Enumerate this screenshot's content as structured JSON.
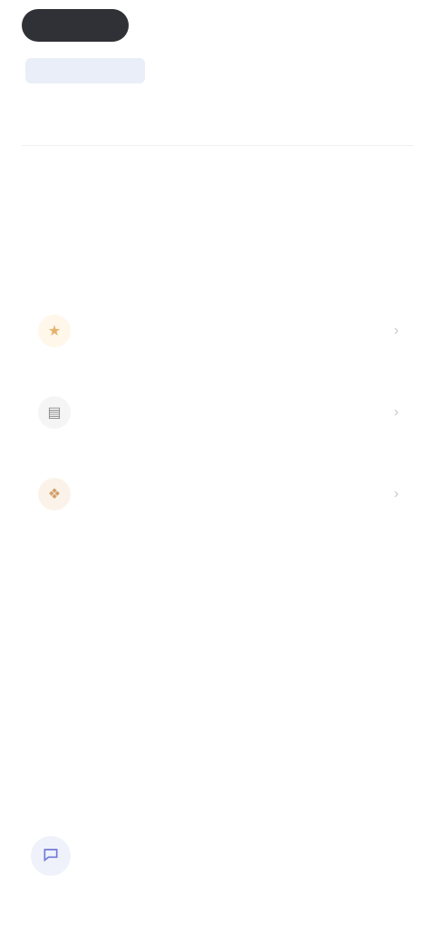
{
  "header": {
    "logo_text": "",
    "language_toggle": "",
    "language_accent": ""
  },
  "subnav": {
    "label": ""
  },
  "breadcrumb": {
    "label": ""
  },
  "main": {
    "headline": ""
  },
  "items": [
    {
      "label": "",
      "icon": "star-icon",
      "icon_color": "#e3b36b",
      "icon_bg": "#fff7ea"
    },
    {
      "label": "",
      "icon": "chart-icon",
      "icon_color": "#8a8a8a",
      "icon_bg": "#f5f5f5"
    },
    {
      "label": "",
      "icon": "bookmark-icon",
      "icon_color": "#d3a06b",
      "icon_bg": "#fbf3ea"
    }
  ],
  "fab": {
    "icon": "chat-icon"
  },
  "colors": {
    "brand_dark": "#2f3136",
    "accent_gold": "#d7a85e",
    "accent_blue_bg": "#e9eef8"
  }
}
